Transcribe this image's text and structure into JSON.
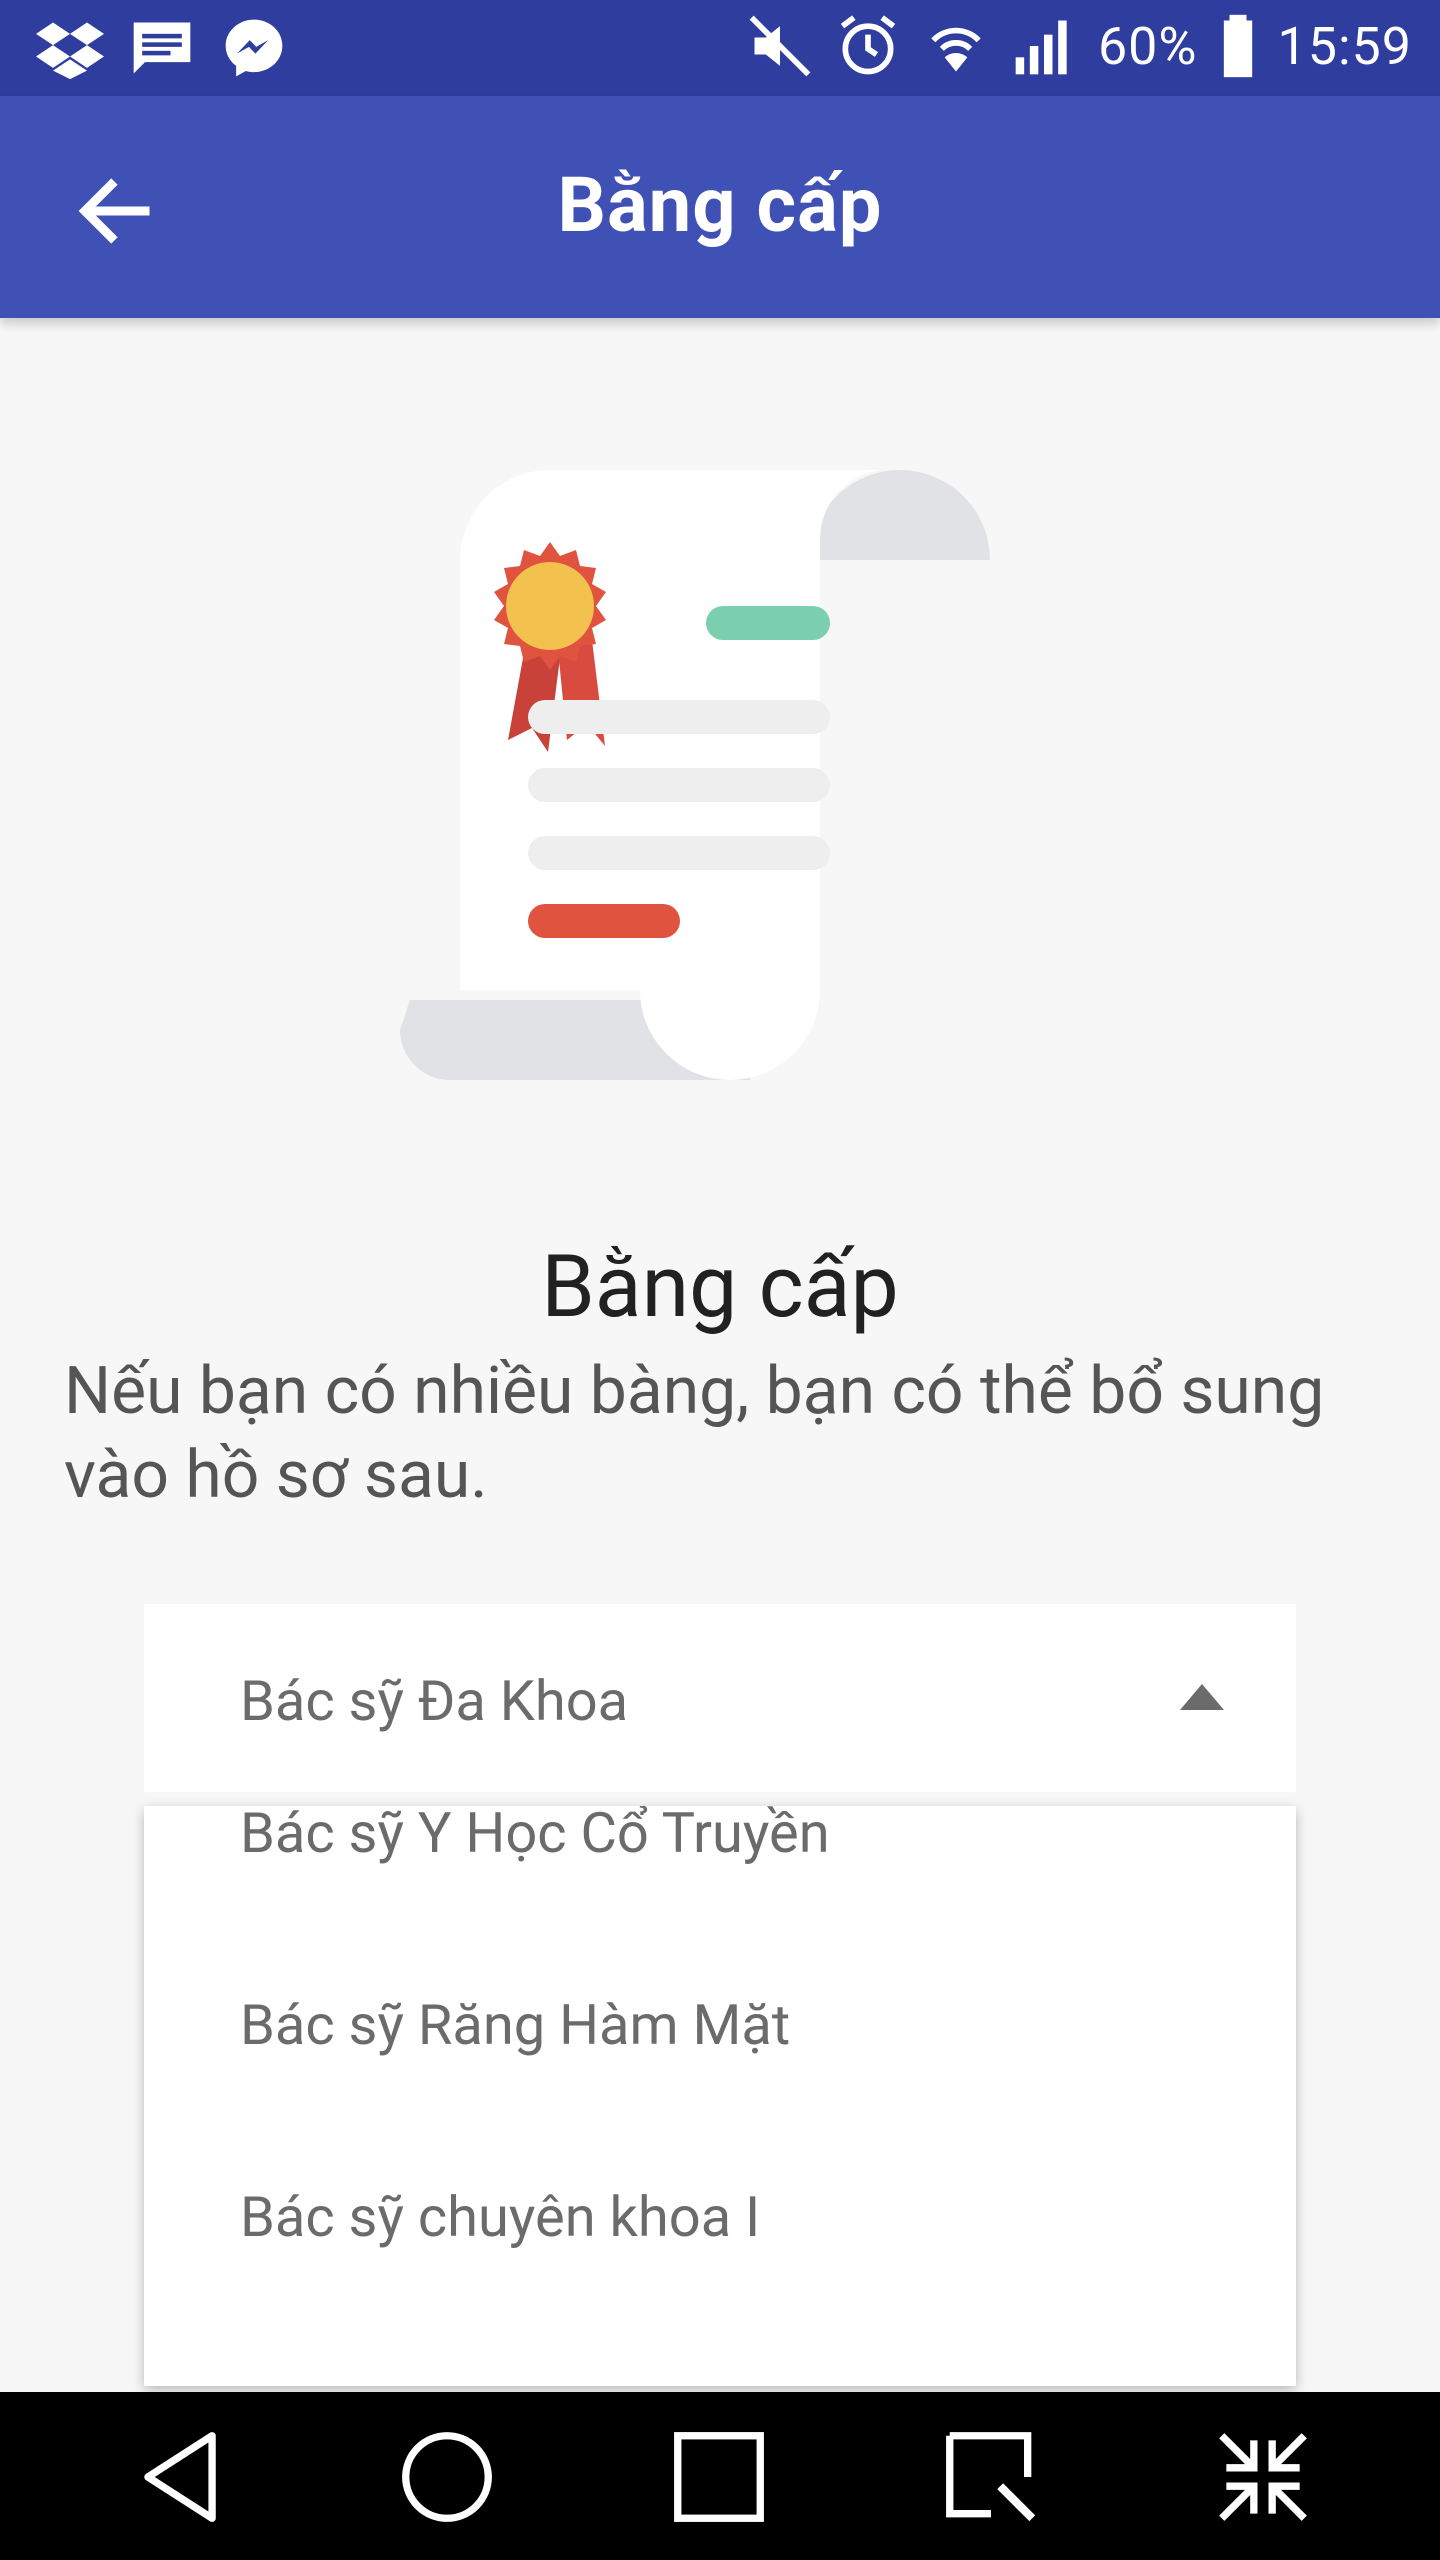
{
  "status_bar": {
    "battery": "60%",
    "time": "15:59",
    "left_icons": [
      "dropbox-icon",
      "message-icon",
      "messenger-icon"
    ],
    "right_icons": [
      "mute-icon",
      "alarm-icon",
      "wifi-icon",
      "signal-icon",
      "battery-icon"
    ]
  },
  "appbar": {
    "title": "Bằng cấp",
    "back_icon": "arrow-left-icon"
  },
  "main": {
    "illustration": "certificate-scroll-illustration",
    "heading": "Bằng cấp",
    "description": "Nếu bạn có nhiều bàng, bạn có thể bổ sung vào hồ sơ sau."
  },
  "spinner": {
    "selected": "Bác sỹ Đa Khoa",
    "arrow_icon": "triangle-up-icon"
  },
  "dropdown": {
    "items": [
      "Bác sỹ Y Học Cổ Truyền",
      "Bác sỹ Răng Hàm Mặt",
      "Bác sỹ chuyên khoa I"
    ]
  },
  "nav_bar": {
    "buttons": [
      "back-triangle-icon",
      "home-circle-icon",
      "recents-square-icon",
      "screenshot-icon",
      "collapse-icon"
    ]
  },
  "colors": {
    "status_bar": "#2f3e9e",
    "app_bar": "#3f51b5",
    "background": "#f7f7f7",
    "badge_orange": "#f2c14e",
    "badge_red": "#e0533f",
    "line_green": "#7ccfae",
    "line_red": "#e0533f"
  }
}
